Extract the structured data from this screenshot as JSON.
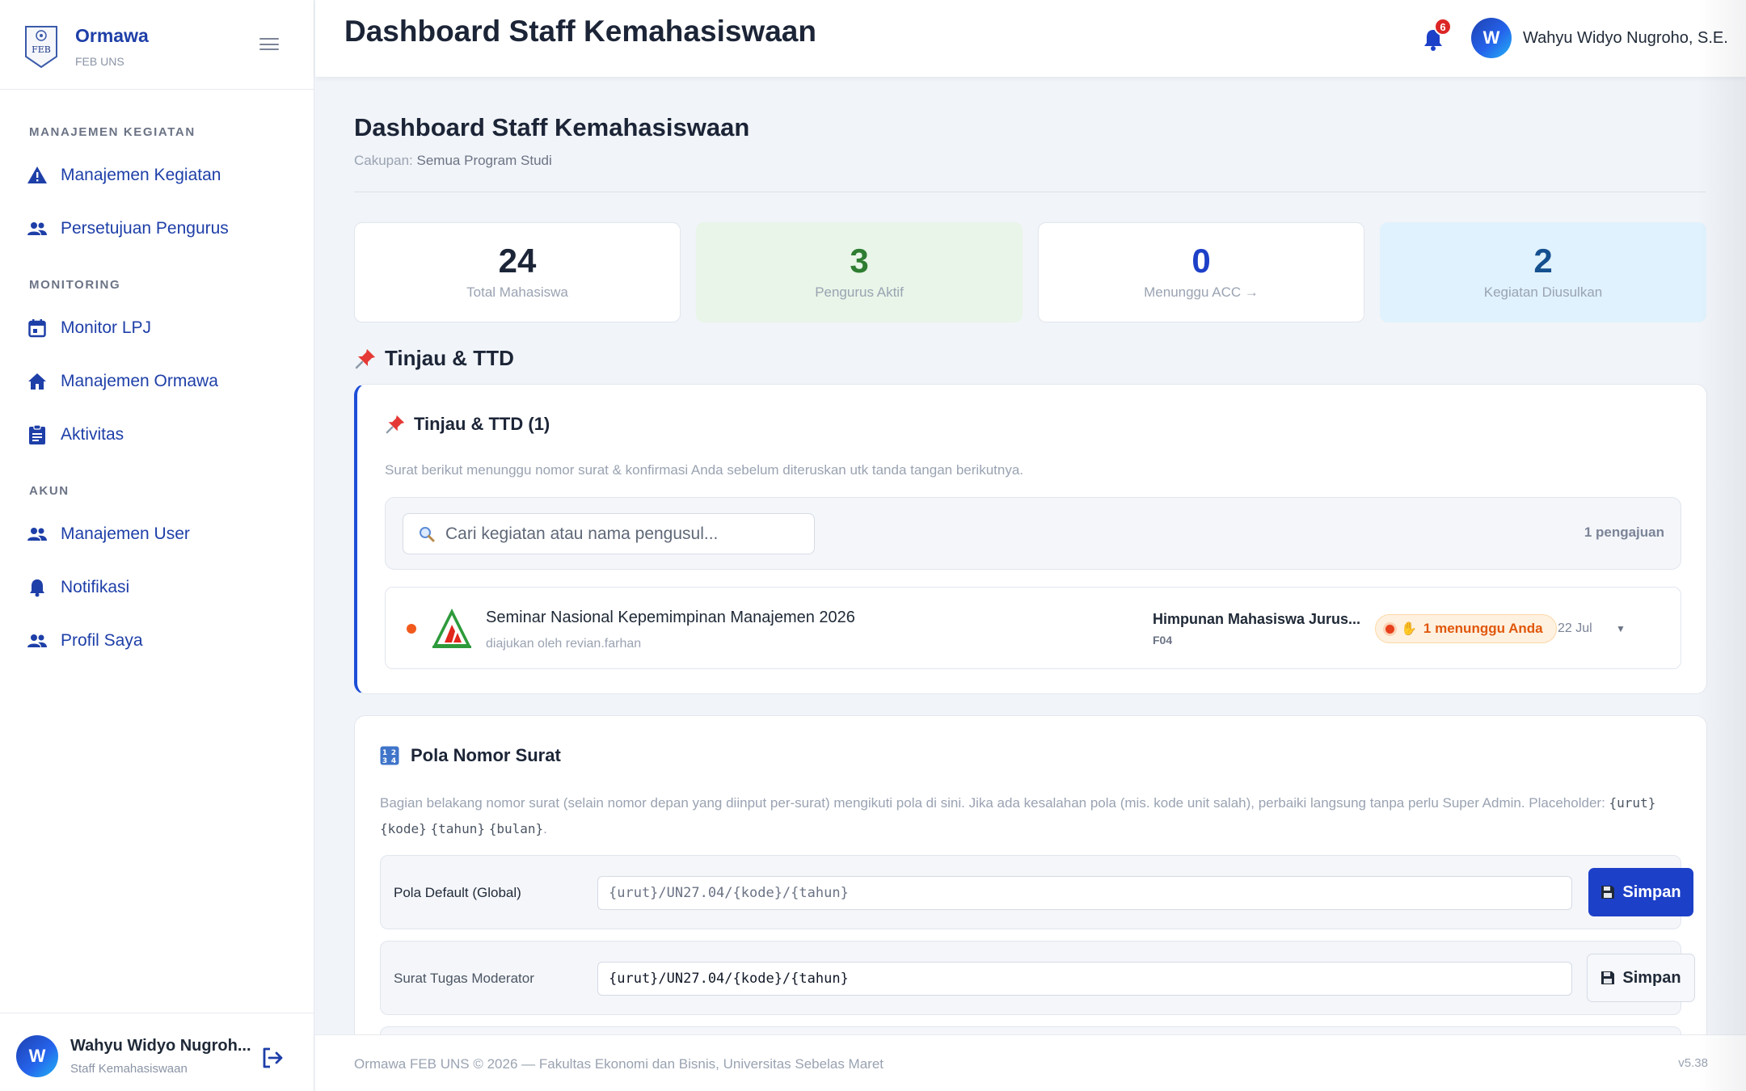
{
  "brand": {
    "name": "Ormawa",
    "sub": "FEB UNS",
    "logo_text": "FEB"
  },
  "sidebar": {
    "sections": [
      {
        "title": "MANAJEMEN KEGIATAN",
        "items": [
          {
            "label": "Manajemen Kegiatan",
            "icon": "warning-icon"
          },
          {
            "label": "Persetujuan Pengurus",
            "icon": "users-icon"
          }
        ]
      },
      {
        "title": "MONITORING",
        "items": [
          {
            "label": "Monitor LPJ",
            "icon": "calendar-icon"
          },
          {
            "label": "Manajemen Ormawa",
            "icon": "home-icon"
          },
          {
            "label": "Aktivitas",
            "icon": "clipboard-icon"
          }
        ]
      },
      {
        "title": "AKUN",
        "items": [
          {
            "label": "Manajemen User",
            "icon": "users-icon"
          },
          {
            "label": "Notifikasi",
            "icon": "bell-icon"
          },
          {
            "label": "Profil Saya",
            "icon": "users-icon"
          }
        ]
      }
    ],
    "user": {
      "initial": "W",
      "name": "Wahyu Widyo Nugroh...",
      "role": "Staff Kemahasiswaan"
    }
  },
  "topbar": {
    "title": "Dashboard Staff Kemahasiswaan",
    "notif_count": "6",
    "user_initial": "W",
    "user_name": "Wahyu Widyo Nugroho, S.E."
  },
  "main": {
    "title": "Dashboard Staff Kemahasiswaan",
    "scope_label": "Cakupan:",
    "scope_value": "Semua Program Studi",
    "stats": [
      {
        "value": "24",
        "label": "Total Mahasiswa",
        "color": "#1c2537"
      },
      {
        "value": "3",
        "label": "Pengurus Aktif",
        "color": "#2e7d32"
      },
      {
        "value": "0",
        "label": "Menunggu ACC →",
        "color": "#1d40c8"
      },
      {
        "value": "2",
        "label": "Kegiatan Diusulkan",
        "color": "#15508f"
      }
    ],
    "review_section": "Tinjau & TTD",
    "review_card": {
      "title": "Tinjau & TTD (1)",
      "description": "Surat berikut menunggu nomor surat & konfirmasi Anda sebelum diteruskan utk tanda tangan berikutnya.",
      "search_placeholder": "Cari kegiatan atau nama pengusul...",
      "count": "1 pengajuan",
      "item": {
        "title": "Seminar Nasional Kepemimpinan Manajemen 2026",
        "submitted_by": "diajukan oleh revian.farhan",
        "org": "Himpunan Mahasiswa Jurus...",
        "code": "F04",
        "status": "1 menunggu Anda",
        "date": "22 Jul"
      }
    },
    "pattern_card": {
      "title": "Pola Nomor Surat",
      "description": "Bagian belakang nomor surat (selain nomor depan yang diinput per-surat) mengikuti pola di sini. Jika ada kesalahan pola (mis. kode unit salah), perbaiki langsung tanpa perlu Super Admin. Placeholder:",
      "placeholders": [
        "{urut}",
        "{kode}",
        "{tahun}",
        "{bulan}"
      ],
      "rows": [
        {
          "label": "Pola Default (Global)",
          "value": "{urut}/UN27.04/{kode}/{tahun}",
          "button": "Simpan"
        },
        {
          "label": "Surat Tugas Moderator",
          "value": "{urut}/UN27.04/{kode}/{tahun}",
          "button": "Simpan"
        }
      ]
    }
  },
  "footer": {
    "text": "Ormawa FEB UNS © 2026 — Fakultas Ekonomi dan Bisnis, Universitas Sebelas Maret",
    "version": "v5.38"
  }
}
